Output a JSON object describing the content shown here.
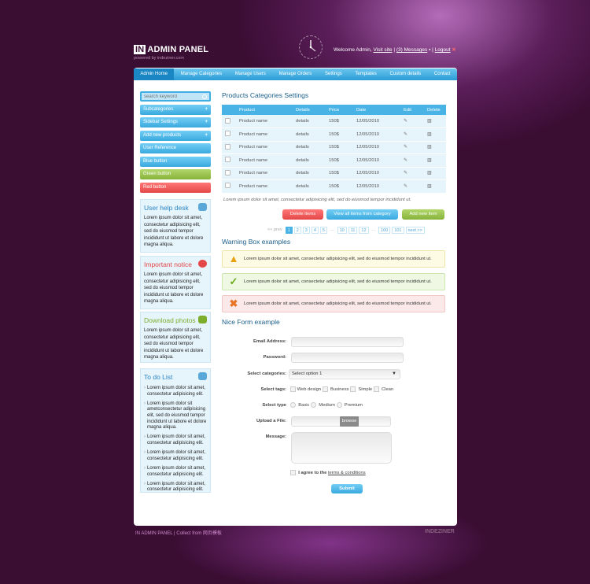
{
  "header": {
    "logo_box": "IN",
    "logo_text": "ADMIN PANEL",
    "logo_sub": "powered by indeziner.com",
    "welcome": "Welcome Admin,",
    "visit_site": "Visit site",
    "messages": "(3) Messages",
    "logout": "Logout"
  },
  "nav": [
    "Admin Home",
    "Manage Categories",
    "Manage Users",
    "Manage Orders",
    "Settings",
    "Templates",
    "Custom details",
    "Contact"
  ],
  "sidebar": {
    "search_placeholder": "search keyword",
    "buttons": [
      "Subcategories",
      "Sidebar Settings",
      "Add new products",
      "User Reference",
      "Blue button",
      "Green button",
      "Red button"
    ],
    "helpdesk": {
      "title": "User help desk",
      "text": "Lorem ipsum dolor sit amet, consectetur adipisicing elit, sed do eiusmod tempor incididunt ut labore et dolore magna aliqua."
    },
    "notice": {
      "title": "Important notice",
      "text": "Lorem ipsum dolor sit amet, consectetur adipisicing elit, sed do eiusmod tempor incididunt ut labore et dolore magna aliqua."
    },
    "download": {
      "title": "Download photos",
      "text": "Lorem ipsum dolor sit amet, consectetur adipisicing elit, sed do eiusmod tempor incididunt ut labore et dolore magna aliqua."
    },
    "todo": {
      "title": "To do List",
      "items": [
        "Lorem ipsum dolor sit amet, consectetur adipisicing elit.",
        "Lorem ipsum dolor sit ametconsectetur adipisicing elit, sed do eiusmod tempor incididunt ut labore et dolore magna aliqua.",
        "Lorem ipsum dolor sit amet, consectetur adipisicing elit.",
        "Lorem ipsum dolor sit amet, consectetur adipisicing elit.",
        "Lorem ipsum dolor sit amet, consectetur adipisicing elit.",
        "Lorem ipsum dolor sit amet, consectetur adipisicing elit."
      ]
    }
  },
  "products": {
    "title": "Products Categories Settings",
    "headers": [
      "",
      "Product",
      "Details",
      "Price",
      "Date",
      "Edit",
      "Delete"
    ],
    "rows": [
      [
        "Product name",
        "details",
        "150$",
        "12/05/2010"
      ],
      [
        "Product name",
        "details",
        "150$",
        "12/05/2010"
      ],
      [
        "Product name",
        "details",
        "150$",
        "12/05/2010"
      ],
      [
        "Product name",
        "details",
        "150$",
        "12/05/2010"
      ],
      [
        "Product name",
        "details",
        "150$",
        "12/05/2010"
      ],
      [
        "Product name",
        "details",
        "150$",
        "12/05/2010"
      ]
    ],
    "note": "Lorem ipsum dolor sit amet, consectetur adipisicing elit, sed do eiusmod tempor incididunt ut.",
    "delete_btn": "Delete items",
    "view_btn": "View all items from category",
    "add_btn": "Add new item"
  },
  "pagination": [
    "<< prev",
    "1",
    "2",
    "3",
    "4",
    "5",
    "...",
    "10",
    "11",
    "12",
    "...",
    "100",
    "101",
    "next >>"
  ],
  "warnings": {
    "title": "Warning Box examples",
    "text": "Lorem ipsum dolor sit amet, consectetur adipisicing elit, sed do eiusmod tempor incididunt ut."
  },
  "form": {
    "title": "Nice Form example",
    "email": "Email Address:",
    "password": "Password:",
    "category": "Select categories:",
    "category_value": "Select option 1",
    "tags": "Select tags:",
    "tag_options": [
      "Web design",
      "Business",
      "Simple",
      "Clean"
    ],
    "type": "Select type",
    "type_options": [
      "Basic",
      "Medium",
      "Premium"
    ],
    "upload": "Upload a File:",
    "browse": "browse",
    "message": "Message:",
    "agree": "I agree to the",
    "terms": "terms & conditions",
    "submit": "Submit"
  },
  "footer": {
    "text": "IN ADMIN PANEL | Collect from 网页模板",
    "brand": "INDEZINER"
  },
  "colors": {
    "accent": "#49b3e5",
    "green": "#86b33a",
    "red": "#e44747",
    "bg": "#3a0d33"
  }
}
